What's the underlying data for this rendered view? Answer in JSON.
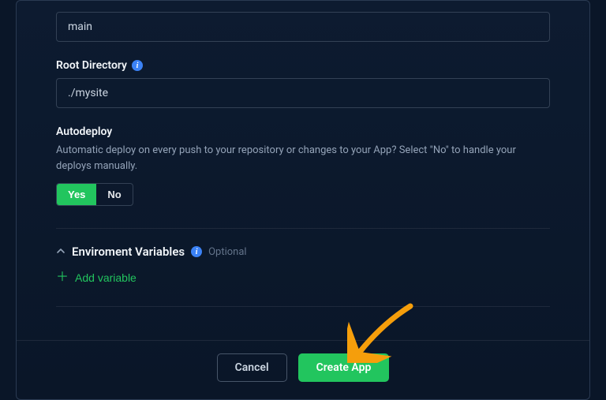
{
  "branchField": {
    "value": "main"
  },
  "rootDir": {
    "label": "Root Directory",
    "value": "./mysite"
  },
  "autodeploy": {
    "label": "Autodeploy",
    "helper": "Automatic deploy on every push to your repository or changes to your App? Select \"No\" to handle your deploys manually.",
    "yes": "Yes",
    "no": "No"
  },
  "envVars": {
    "title": "Enviroment Variables",
    "optional": "Optional",
    "addLabel": "Add variable"
  },
  "footer": {
    "cancel": "Cancel",
    "create": "Create App"
  }
}
